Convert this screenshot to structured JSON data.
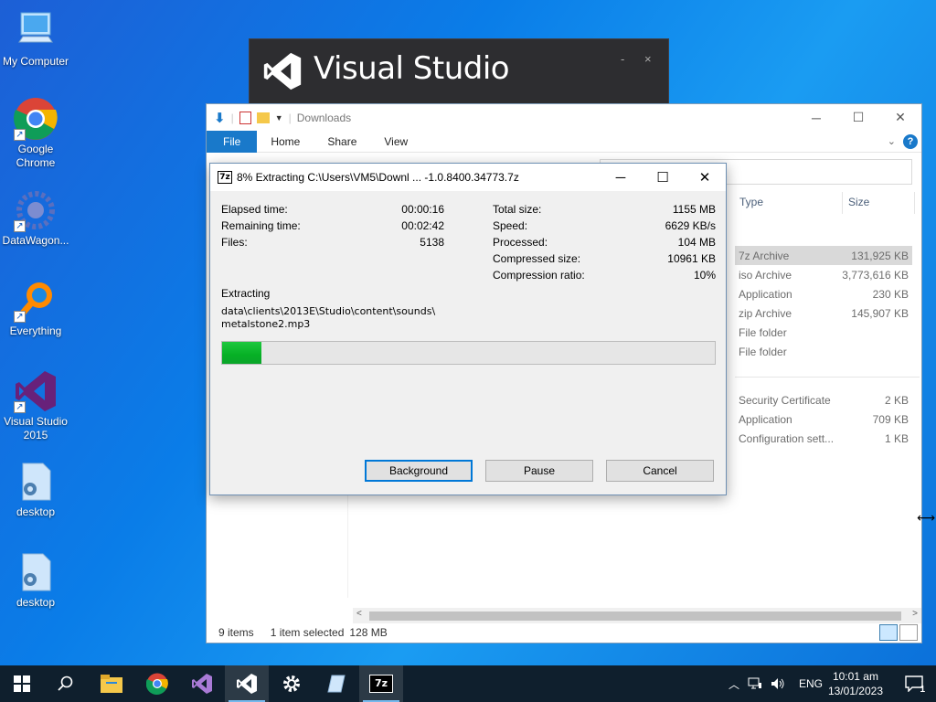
{
  "desktop": {
    "icons": [
      {
        "label": "My Computer"
      },
      {
        "label": "Google Chrome"
      },
      {
        "label": "DataWagon..."
      },
      {
        "label": "Everything"
      },
      {
        "label": "Visual Studio 2015"
      },
      {
        "label": "desktop"
      },
      {
        "label": "desktop"
      }
    ]
  },
  "vs_splash": {
    "title": "Visual Studio",
    "min": "-",
    "close": "×"
  },
  "explorer": {
    "title": "Downloads",
    "tabs": {
      "file": "File",
      "home": "Home",
      "share": "Share",
      "view": "View"
    },
    "help": "?",
    "columns": {
      "type": "Type",
      "size": "Size"
    },
    "rows": [
      {
        "type": "7z Archive",
        "size": "131,925 KB"
      },
      {
        "type": "iso Archive",
        "size": "3,773,616 KB"
      },
      {
        "type": "Application",
        "size": "230 KB"
      },
      {
        "type": "zip Archive",
        "size": "145,907 KB"
      },
      {
        "type": "File folder",
        "size": ""
      },
      {
        "type": "File folder",
        "size": ""
      },
      {
        "type": "Security Certificate",
        "size": "2 KB"
      },
      {
        "type": "Application",
        "size": "709 KB"
      },
      {
        "type": "Configuration sett...",
        "size": "1 KB"
      }
    ],
    "status": {
      "items": "9 items",
      "selected": "1 item selected",
      "size": "128 MB"
    }
  },
  "zip": {
    "title": "8% Extracting C:\\Users\\VM5\\Downl ... -1.0.8400.34773.7z",
    "logo": "7z",
    "left_stats": [
      {
        "label": "Elapsed time:",
        "value": "00:00:16"
      },
      {
        "label": "Remaining time:",
        "value": "00:02:42"
      },
      {
        "label": "Files:",
        "value": "5138"
      }
    ],
    "right_stats": [
      {
        "label": "Total size:",
        "value": "1155 MB"
      },
      {
        "label": "Speed:",
        "value": "6629 KB/s"
      },
      {
        "label": "Processed:",
        "value": "104 MB"
      },
      {
        "label": "Compressed size:",
        "value": "10961 KB"
      },
      {
        "label": "Compression ratio:",
        "value": "10%"
      }
    ],
    "extracting_label": "Extracting",
    "path_line1": "data\\clients\\2013E\\Studio\\content\\sounds\\",
    "path_line2": "metalstone2.mp3",
    "progress_percent": 8,
    "buttons": {
      "background": "Background",
      "pause": "Pause",
      "cancel": "Cancel"
    }
  },
  "taskbar": {
    "lang": "ENG",
    "time": "10:01 am",
    "date": "13/01/2023",
    "notification_count": "1",
    "zip_label": "7z"
  },
  "colors": {
    "accent": "#1979ca",
    "progress": "#06b025",
    "taskbar": "#0f1f2d"
  }
}
